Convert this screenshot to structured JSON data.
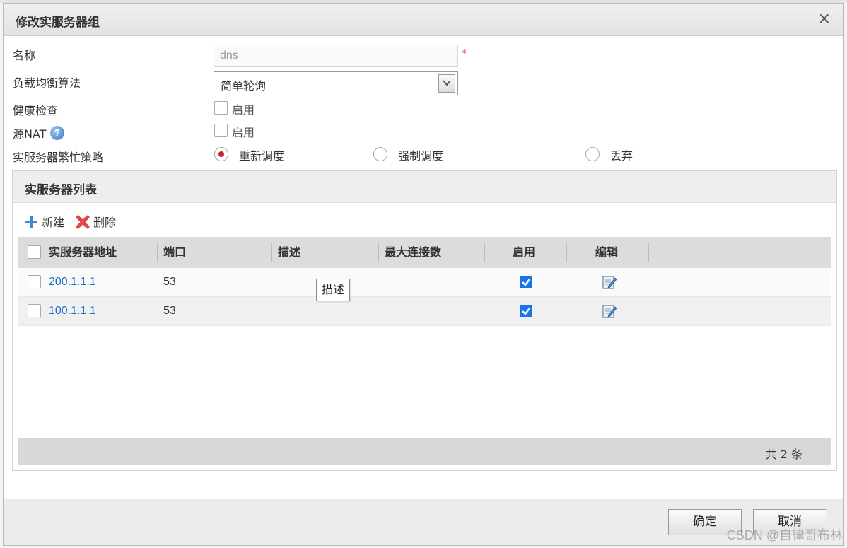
{
  "dialog": {
    "title": "修改实服务器组",
    "close_glyph": "×"
  },
  "form": {
    "name_label": "名称",
    "name_value": "dns",
    "required_mark": "*",
    "algo_label": "负载均衡算法",
    "algo_value": "简单轮询",
    "health_label": "健康检查",
    "health_option": "启用",
    "snat_label": "源NAT",
    "snat_help": "?",
    "snat_option": "启用",
    "busy_label": "实服务器繁忙策略",
    "busy_options": [
      "重新调度",
      "强制调度",
      "丢弃"
    ],
    "busy_selected": "重新调度"
  },
  "panel": {
    "title": "实服务器列表",
    "new_label": "新建",
    "delete_label": "删除"
  },
  "table": {
    "columns": [
      "实服务器地址",
      "端口",
      "描述",
      "最大连接数",
      "启用",
      "编辑"
    ],
    "rows": [
      {
        "address": "200.1.1.1",
        "port": "53",
        "description": "",
        "max_conn": "",
        "enabled": true
      },
      {
        "address": "100.1.1.1",
        "port": "53",
        "description": "",
        "max_conn": "",
        "enabled": true
      }
    ],
    "tooltip": "描述",
    "footer": "共 2 条"
  },
  "buttons": {
    "ok": "确定",
    "cancel": "取消"
  },
  "watermark": "CSDN @自律哥布林",
  "colors": {
    "link": "#1a6fc9",
    "radio_selected": "#c0272d",
    "checkbox_checked": "#1a73e8",
    "required": "#e04040"
  }
}
